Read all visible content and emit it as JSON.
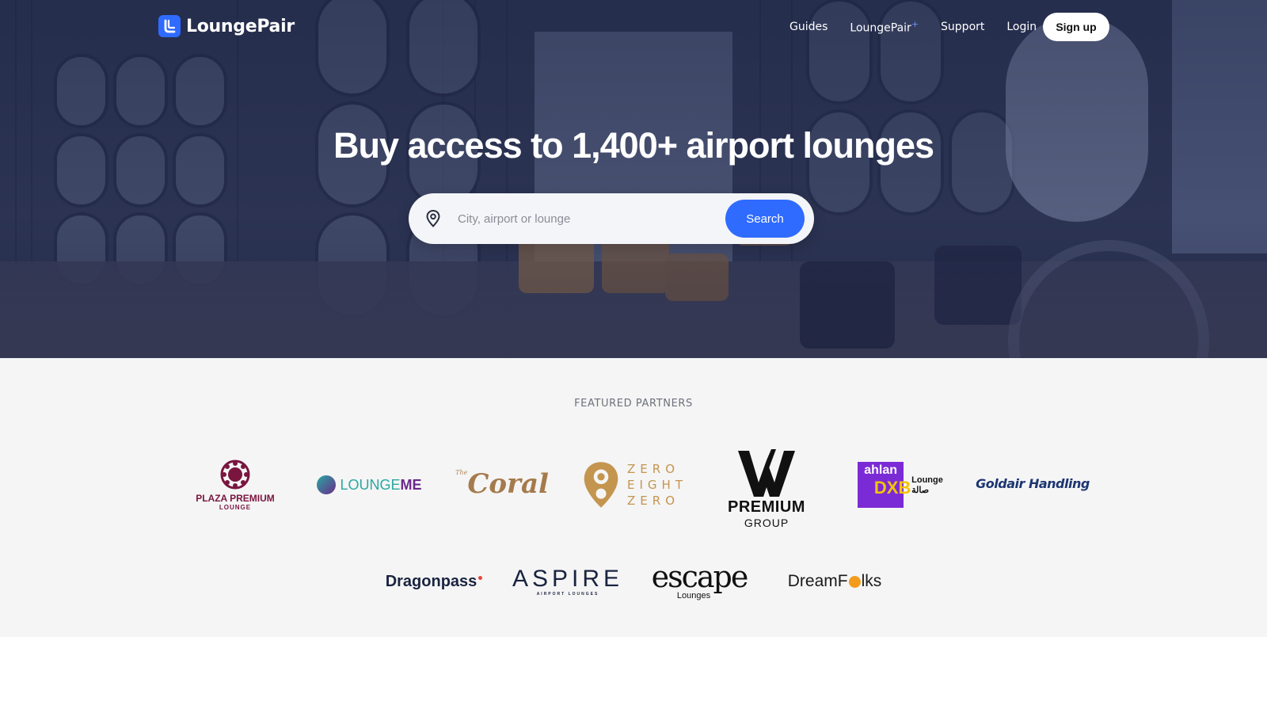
{
  "brand": {
    "name": "LoungePair",
    "accent": "#2f6bff"
  },
  "nav": {
    "links": [
      {
        "label": "Guides"
      },
      {
        "label": "LoungePair",
        "suffix": "+"
      },
      {
        "label": "Support"
      },
      {
        "label": "Login"
      }
    ],
    "signup_label": "Sign up"
  },
  "hero": {
    "title": "Buy access to 1,400+ airport lounges",
    "search": {
      "placeholder": "City, airport or lounge",
      "value": "",
      "button_label": "Search",
      "icon": "location-pin-icon"
    }
  },
  "partners": {
    "heading": "FEATURED PARTNERS",
    "logos": {
      "plaza_premium": {
        "line1": "PLAZA PREMIUM",
        "line2": "LOUNGE"
      },
      "loungeme": {
        "text_a": "LOUNGE",
        "text_b": "ME"
      },
      "coral": {
        "small": "The",
        "text": "Coral"
      },
      "zero_eight_zero": {
        "line1": "ZERO",
        "line2": "EIGHT",
        "line3": "ZERO"
      },
      "premium_group": {
        "line1": "PREMIUM",
        "line2": "GROUP"
      },
      "ahlan": {
        "text": "ahlan",
        "sub": "DXB",
        "lounge_en": "Lounge",
        "lounge_ar": "صالة"
      },
      "goldair": {
        "text": "Goldair Handling"
      },
      "dragonpass": {
        "text": "Dragonpass"
      },
      "aspire": {
        "text": "ASPIRE",
        "sub": "AIRPORT LOUNGES"
      },
      "escape": {
        "text": "escape",
        "sub": "Lounges"
      },
      "dreamfolks": {
        "text_a": "Dream",
        "text_b": "F",
        "text_c": "lks"
      }
    }
  }
}
